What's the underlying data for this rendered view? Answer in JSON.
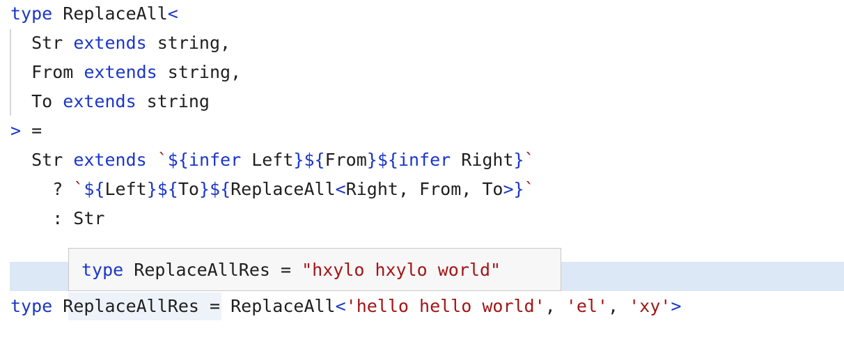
{
  "editor": {
    "lines": [
      {
        "tokens": [
          {
            "t": "type",
            "c": "kw"
          },
          {
            "t": " ReplaceAll"
          },
          {
            "t": "<",
            "c": "kw"
          }
        ]
      },
      {
        "tokens": [
          {
            "t": "  Str "
          },
          {
            "t": "extends",
            "c": "kw"
          },
          {
            "t": " string,"
          }
        ]
      },
      {
        "tokens": [
          {
            "t": "  From "
          },
          {
            "t": "extends",
            "c": "kw"
          },
          {
            "t": " string,"
          }
        ]
      },
      {
        "tokens": [
          {
            "t": "  To "
          },
          {
            "t": "extends",
            "c": "kw"
          },
          {
            "t": " string"
          }
        ]
      },
      {
        "tokens": [
          {
            "t": ">",
            "c": "kw"
          },
          {
            "t": " ="
          }
        ]
      },
      {
        "tokens": [
          {
            "t": "  Str "
          },
          {
            "t": "extends",
            "c": "kw"
          },
          {
            "t": " "
          },
          {
            "t": "`",
            "c": "str"
          },
          {
            "t": "${infer",
            "c": "kw"
          },
          {
            "t": " Left"
          },
          {
            "t": "}${",
            "c": "kw"
          },
          {
            "t": "From"
          },
          {
            "t": "}${infer",
            "c": "kw"
          },
          {
            "t": " Right"
          },
          {
            "t": "}",
            "c": "kw"
          },
          {
            "t": "`",
            "c": "str"
          }
        ]
      },
      {
        "tokens": [
          {
            "t": "    ? "
          },
          {
            "t": "`",
            "c": "str"
          },
          {
            "t": "${",
            "c": "kw"
          },
          {
            "t": "Left"
          },
          {
            "t": "}${",
            "c": "kw"
          },
          {
            "t": "To"
          },
          {
            "t": "}${",
            "c": "kw"
          },
          {
            "t": "ReplaceAll"
          },
          {
            "t": "<",
            "c": "kw"
          },
          {
            "t": "Right, From, To"
          },
          {
            "t": ">}",
            "c": "kw"
          },
          {
            "t": "`",
            "c": "str"
          }
        ]
      },
      {
        "tokens": [
          {
            "t": "    : Str"
          }
        ]
      },
      {
        "tokens": [
          {
            "t": ""
          }
        ]
      },
      {
        "tokens": [
          {
            "t": ""
          }
        ]
      },
      {
        "tokens": [
          {
            "t": "type",
            "c": "kw"
          },
          {
            "t": " ReplaceAllRes = ReplaceAll"
          },
          {
            "t": "<",
            "c": "kw"
          },
          {
            "t": "'hello hello world'",
            "c": "str"
          },
          {
            "t": ", "
          },
          {
            "t": "'el'",
            "c": "str"
          },
          {
            "t": ", "
          },
          {
            "t": "'xy'",
            "c": "str"
          },
          {
            "t": ">",
            "c": "kw"
          }
        ]
      }
    ]
  },
  "tooltip": {
    "tokens": [
      {
        "t": "type",
        "c": "kw"
      },
      {
        "t": " ReplaceAllRes = "
      },
      {
        "t": "\"hxylo hxylo world\"",
        "c": "str"
      }
    ]
  },
  "colors": {
    "keyword": "#1a36c9",
    "string": "#a31515",
    "text": "#1f1f1f",
    "line_highlight": "#dce8f6"
  }
}
